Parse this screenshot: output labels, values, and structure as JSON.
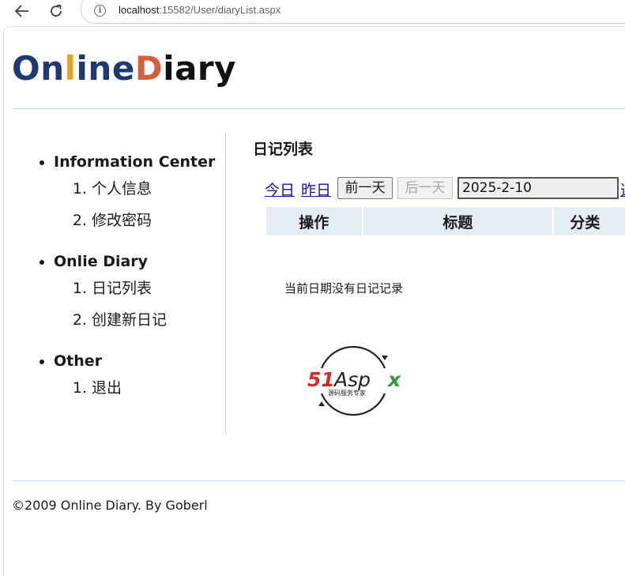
{
  "browser": {
    "url_host": "localhost",
    "url_rest": ":15582/User/diaryList.aspx",
    "back_icon": "arrow-left-icon",
    "reload_icon": "reload-icon",
    "info_icon": "info-icon"
  },
  "header": {
    "logo_part_1": "On",
    "logo_part_2": "l",
    "logo_part_3": "ine",
    "logo_part_4": "D",
    "logo_part_5": "iary",
    "logo_colors": {
      "primary": "#1f3a73",
      "accent_l": "#e8a317",
      "accent_d": "#d2603a",
      "rest": "#111111"
    }
  },
  "sidebar": {
    "sections": [
      {
        "title": "Information Center",
        "items": [
          "个人信息",
          "修改密码"
        ]
      },
      {
        "title": "Onlie Diary",
        "items": [
          "日记列表",
          "创建新日记"
        ]
      },
      {
        "title": "Other",
        "items": [
          "退出"
        ]
      }
    ]
  },
  "main": {
    "title": "日记列表",
    "nav": {
      "today": "今日",
      "yesterday": "昨日",
      "prev_day": "前一天",
      "next_day": "后一天",
      "date_value": "2025-2-10",
      "select_link": "选"
    },
    "table": {
      "headers": [
        "操作",
        "标题",
        "分类"
      ]
    },
    "empty_message": "当前日期没有日记记录",
    "watermark": {
      "brand": "51Aspx",
      "tagline": "源码服务专家"
    }
  },
  "footer": {
    "text": "©2009 Online Diary. By Goberl"
  }
}
